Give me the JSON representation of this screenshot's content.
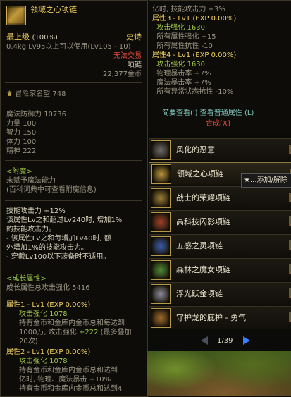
{
  "left_tooltip": {
    "item_name": "领域之心项链",
    "grade": "最上级",
    "grade_pct": "(100%)",
    "rarity": "史诗",
    "weight_level": "0.4kg  Lv95以上可以使用(Lv105 - 10)",
    "trade": "无法交易",
    "slot": "项链",
    "price": "22,377金币",
    "adventurer_fame_label": "冒险家名望",
    "adventurer_fame_value": "748",
    "stats": [
      {
        "label": "魔法防御力",
        "value": "10736"
      },
      {
        "label": "力量",
        "value": "100"
      },
      {
        "label": "智力",
        "value": "150"
      },
      {
        "label": "体力",
        "value": "100"
      },
      {
        "label": "精神",
        "value": "222"
      }
    ],
    "enchant_header": "<附魔>",
    "enchant_line1": "未赋予魔法能力",
    "enchant_line2": "(百科词典中可查看附魔信息)",
    "skill_lines": [
      "技能攻击力 +12%",
      "该属性Lv之和超过Lv240时, 增加1%",
      "的技能攻击力。",
      "- 该属性Lv之和每增加Lv40时, 额",
      "外增加1%的技能攻击力。",
      "- 穿戴Lv100以下装备时不适用。"
    ],
    "growth_header": "<成长属性>",
    "growth_total": "成长属性总攻击强化 5416",
    "growth1_title": "属性1 - Lv1 (EXP 0.00%)",
    "growth1_atk": "攻击强化 1078",
    "growth1_desc1": "持有金币和金库内金币总和每达到",
    "growth1_desc2a": "1000万, 攻击强化",
    "growth1_desc2b": "+222",
    "growth1_desc2c": "(最多叠加",
    "growth1_desc3": "20次)",
    "growth2_title": "属性2 - Lv1 (EXP 0.00%)",
    "growth2_atk": "攻击强化 1078",
    "growth2_desc1": "持有金币和金库内金币总和达到",
    "growth2_desc2": "亿时, 物理、魔法暴击 +10%",
    "growth2_desc3": "持有金币和金库内金币总和达到4"
  },
  "right_tooltip": {
    "lines_top": [
      {
        "text": "亿时, 技能攻击力 +3%",
        "cls": "gr"
      },
      {
        "text": "属性3 - Lv1 (EXP 0.00%)",
        "cls": "y"
      },
      {
        "text": "  攻击强化 1630",
        "cls": "g"
      },
      {
        "text": "  所有属性强化 +15",
        "cls": "gr"
      },
      {
        "text": "  所有属性抗性 -10",
        "cls": "gr"
      },
      {
        "text": "属性4 - Lv1 (EXP 0.00%)",
        "cls": "y"
      },
      {
        "text": "  攻击强化 1630",
        "cls": "g"
      },
      {
        "text": "  物理暴击率 +7%",
        "cls": "gr"
      },
      {
        "text": "  魔法暴击率 +7%",
        "cls": "gr"
      },
      {
        "text": "  所有异常状态抗性 -10%",
        "cls": "gr"
      }
    ],
    "brief_view": "简要查看",
    "brief_key": "(')",
    "normal_view": "查看普通属性",
    "normal_key": "(L)",
    "synth": "合成[X]"
  },
  "item_list": [
    {
      "name": "风化的恶意",
      "color": "#6a6a6a"
    },
    {
      "name": "领域之心项链",
      "color": "#b8933a"
    },
    {
      "name": "战士的荣耀项链",
      "color": "#9a7b35"
    },
    {
      "name": "高科技闪影项链",
      "color": "#a0402a"
    },
    {
      "name": "五感之灵项链",
      "color": "#3a5ba8"
    },
    {
      "name": "森林之魔女项链",
      "color": "#4f8a36"
    },
    {
      "name": "浮光跃金项链",
      "color": "#8a8a9a"
    },
    {
      "name": "守护龙的庇护 - 勇气",
      "color": "#a06a2a"
    }
  ],
  "context_tip": "★...添加/解除",
  "pager": {
    "text": "1/39"
  },
  "colors": {
    "epic": "#f0d060",
    "green": "#9fc54a",
    "red": "#e24a3a"
  }
}
